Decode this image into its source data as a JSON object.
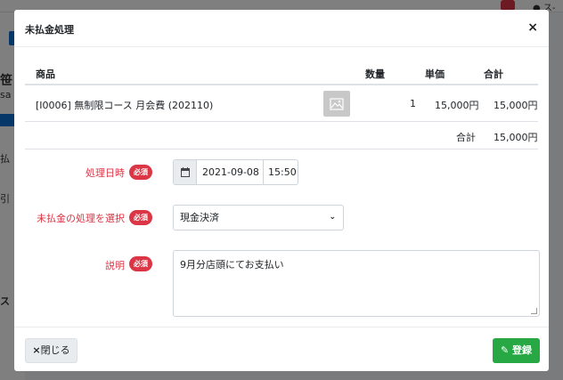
{
  "modal": {
    "title": "未払金処理",
    "close_glyph": "×"
  },
  "table": {
    "headers": {
      "product": "商品",
      "quantity": "数量",
      "unit_price": "単価",
      "total": "合計"
    },
    "rows": [
      {
        "product": "[I0006]  無制限コース 月会費 (202110)",
        "quantity": "1",
        "unit_price": "15,000円",
        "total": "15,000円"
      }
    ],
    "total_label": "合計",
    "total_value": "15,000円"
  },
  "form": {
    "required_badge": "必須",
    "datetime_label": "処理日時",
    "date_value": "2021-09-08",
    "time_value": "15:50",
    "method_label": "未払金の処理を選択",
    "method_value": "現金決済",
    "description_label": "説明",
    "description_value": "9月分店頭にてお支払い"
  },
  "footer": {
    "close_label": "閉じる",
    "save_label": "登録"
  },
  "colors": {
    "required": "#dc3545",
    "save": "#28a745"
  }
}
